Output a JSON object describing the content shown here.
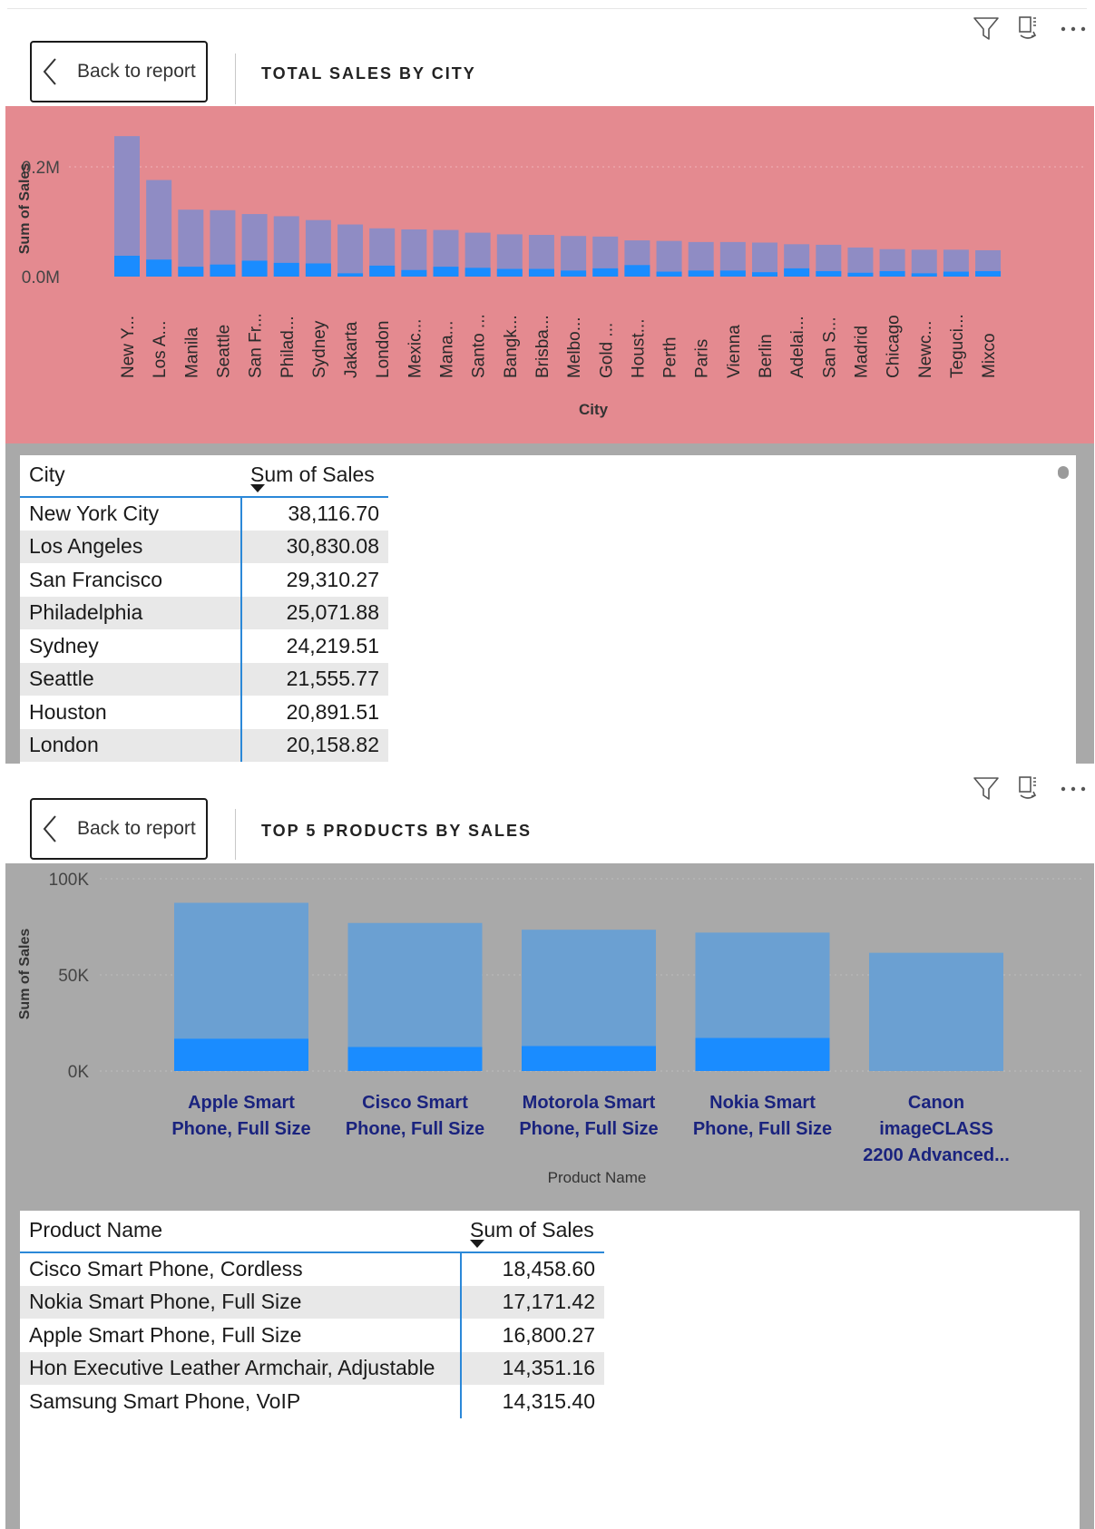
{
  "colors": {
    "chart1_bg": "#e48a90",
    "chart1_bar_total": "#8f8cc4",
    "chart1_bar_highlight": "#1a8cff",
    "chart2_bg": "#a9a9a9",
    "chart2_bar_total": "#6ba0d2",
    "chart2_bar_highlight": "#1a8cff",
    "table_rule": "#2b88d8"
  },
  "icons": [
    "filter-icon",
    "focus-mode-icon",
    "more-options-icon",
    "back-chevron-icon"
  ],
  "visuals": [
    {
      "back_label": "Back to report",
      "title": "TOTAL SALES BY CITY",
      "table": {
        "headers": [
          "City",
          "Sum of Sales"
        ],
        "rows": [
          [
            "New York City",
            "38,116.70"
          ],
          [
            "Los Angeles",
            "30,830.08"
          ],
          [
            "San Francisco",
            "29,310.27"
          ],
          [
            "Philadelphia",
            "25,071.88"
          ],
          [
            "Sydney",
            "24,219.51"
          ],
          [
            "Seattle",
            "21,555.77"
          ],
          [
            "Houston",
            "20,891.51"
          ],
          [
            "London",
            "20,158.82"
          ]
        ]
      }
    },
    {
      "back_label": "Back to report",
      "title": "TOP 5 PRODUCTS BY SALES",
      "table": {
        "headers": [
          "Product Name",
          "Sum of Sales"
        ],
        "rows": [
          [
            "Cisco Smart Phone, Cordless",
            "18,458.60"
          ],
          [
            "Nokia Smart Phone, Full Size",
            "17,171.42"
          ],
          [
            "Apple Smart Phone, Full Size",
            "16,800.27"
          ],
          [
            "Hon Executive Leather Armchair, Adjustable",
            "14,351.16"
          ],
          [
            "Samsung Smart Phone, VoIP",
            "14,315.40"
          ]
        ]
      }
    }
  ],
  "chart_data": [
    {
      "type": "bar",
      "xlabel": "City",
      "ylabel": "Sum of Sales",
      "yticks": [
        "0.0M",
        "0.2M"
      ],
      "ylim": [
        0,
        0.2
      ],
      "grid": true,
      "categories": [
        "New Y...",
        "Los A...",
        "Manila",
        "Seattle",
        "San Fr...",
        "Philad...",
        "Sydney",
        "Jakarta",
        "London",
        "Mexic...",
        "Mana...",
        "Santo ...",
        "Bangk...",
        "Brisba...",
        "Melbo...",
        "Gold ...",
        "Houst...",
        "Perth",
        "Paris",
        "Vienna",
        "Berlin",
        "Adelai...",
        "San S...",
        "Madrid",
        "Chicago",
        "Newc...",
        "Teguci...",
        "Mixco"
      ],
      "series": [
        {
          "values": [
            0.256,
            0.176,
            0.122,
            0.121,
            0.114,
            0.11,
            0.103,
            0.095,
            0.088,
            0.086,
            0.085,
            0.08,
            0.077,
            0.076,
            0.074,
            0.073,
            0.066,
            0.065,
            0.063,
            0.063,
            0.062,
            0.059,
            0.058,
            0.053,
            0.05,
            0.049,
            0.049,
            0.048
          ]
        },
        {
          "values": [
            0.038,
            0.031,
            0.018,
            0.022,
            0.029,
            0.025,
            0.024,
            0.006,
            0.02,
            0.012,
            0.018,
            0.016,
            0.014,
            0.014,
            0.011,
            0.015,
            0.021,
            0.009,
            0.011,
            0.011,
            0.008,
            0.015,
            0.01,
            0.007,
            0.01,
            0.006,
            0.009,
            0.01
          ]
        }
      ]
    },
    {
      "type": "bar",
      "xlabel": "Product Name",
      "ylabel": "Sum of Sales",
      "yticks": [
        "0K",
        "50K",
        "100K"
      ],
      "ylim": [
        0,
        100000
      ],
      "grid": true,
      "categories": [
        [
          "Apple Smart",
          "Phone, Full Size"
        ],
        [
          "Cisco Smart",
          "Phone, Full Size"
        ],
        [
          "Motorola Smart",
          "Phone, Full Size"
        ],
        [
          "Nokia Smart",
          "Phone, Full Size"
        ],
        [
          "Canon",
          "imageCLASS",
          "2200 Advanced..."
        ]
      ],
      "series": [
        {
          "values": [
            87500,
            77000,
            73500,
            72000,
            61500
          ]
        },
        {
          "values": [
            16800,
            12500,
            13000,
            17200,
            0
          ]
        }
      ]
    }
  ]
}
